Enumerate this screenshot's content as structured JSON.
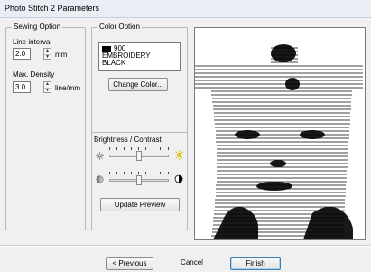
{
  "window": {
    "title": "Photo Stitch 2 Parameters"
  },
  "sewing_option": {
    "legend": "Sewing Option",
    "line_interval_label": "Line interval",
    "line_interval_value": "2.0",
    "line_interval_unit": "mm",
    "max_density_label": "Max. Density",
    "max_density_value": "3.0",
    "max_density_unit": "line/mm"
  },
  "color_option": {
    "legend": "Color Option",
    "color_code": "900",
    "color_brand": "EMBROIDERY",
    "color_name": "BLACK",
    "swatch_color": "#000000",
    "change_color_label": "Change Color..."
  },
  "brightness_contrast": {
    "legend": "Brightness / Contrast",
    "brightness_icon": "sun-icon",
    "contrast_icon": "contrast-icon",
    "brightness_level": 0.5,
    "contrast_level": 0.5
  },
  "update_preview_label": "Update Preview",
  "footer": {
    "previous_label": "< Previous",
    "cancel_label": "Cancel",
    "finish_label": "Finish"
  }
}
